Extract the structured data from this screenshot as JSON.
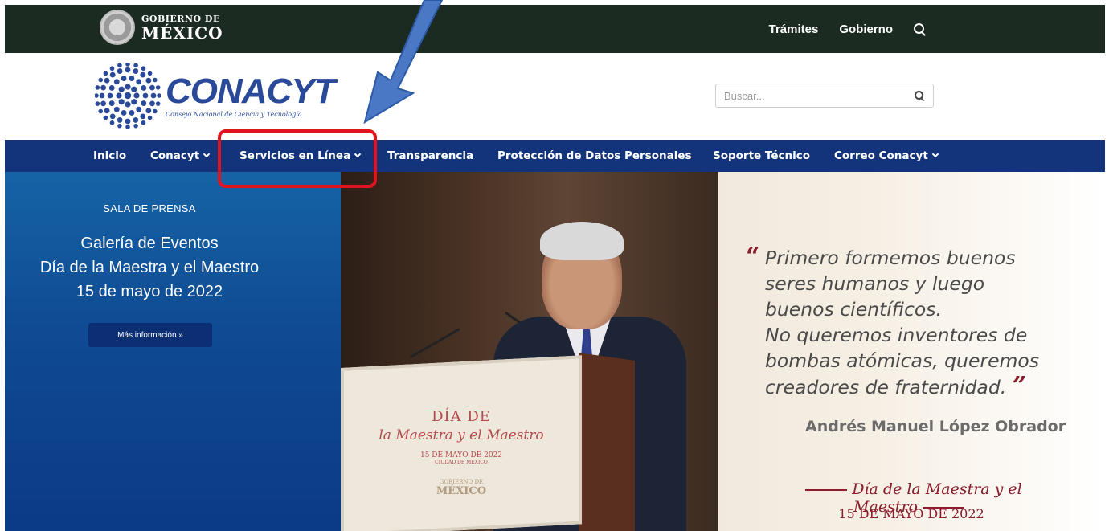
{
  "gov_bar": {
    "logo_line1": "GOBIERNO DE",
    "logo_line2": "MÉXICO",
    "links": [
      "Trámites",
      "Gobierno"
    ],
    "search_icon": "search-icon"
  },
  "header": {
    "logo_name": "CONACYT",
    "logo_sub": "Consejo Nacional de Ciencia y Tecnología",
    "search_placeholder": "Buscar...",
    "search_button_icon": "search-icon"
  },
  "nav": {
    "items": [
      {
        "label": "Inicio",
        "has_dropdown": false
      },
      {
        "label": "Conacyt",
        "has_dropdown": true
      },
      {
        "label": "Servicios en Línea",
        "has_dropdown": true
      },
      {
        "label": "Transparencia",
        "has_dropdown": false
      },
      {
        "label": "Protección de Datos Personales",
        "has_dropdown": false
      },
      {
        "label": "Soporte Técnico",
        "has_dropdown": false
      },
      {
        "label": "Correo Conacyt",
        "has_dropdown": true
      }
    ]
  },
  "hero": {
    "press_label": "SALA DE PRENSA",
    "title_lines": [
      "Galería de Eventos",
      "Día de la Maestra y el Maestro",
      "15 de mayo de 2022"
    ],
    "more_button": "Más información »",
    "podium": {
      "line1": "DÍA DE",
      "line2": "la Maestra y el Maestro",
      "line3": "15 DE MAYO DE 2022",
      "line4": "CIUDAD DE MÉXICO",
      "line5": "GOBIERNO DE",
      "line6": "MÉXICO"
    },
    "quote_lines": [
      "Primero formemos buenos",
      "seres humanos y luego",
      "buenos científicos.",
      "No queremos inventores de",
      "bombas atómicas, queremos",
      "creadores de fraternidad."
    ],
    "quote_open": "“",
    "quote_close": "”",
    "author": "Andrés Manuel López Obrador",
    "event_name": "Día de la Maestra y el Maestro",
    "event_date": "15 DE MAYO DE 2022"
  },
  "colors": {
    "gov_bar": "#1b2b22",
    "nav": "#13347a",
    "highlight": "#e0141e",
    "arrow": "#4a78c4",
    "accent_maroon": "#8a1c2b"
  }
}
